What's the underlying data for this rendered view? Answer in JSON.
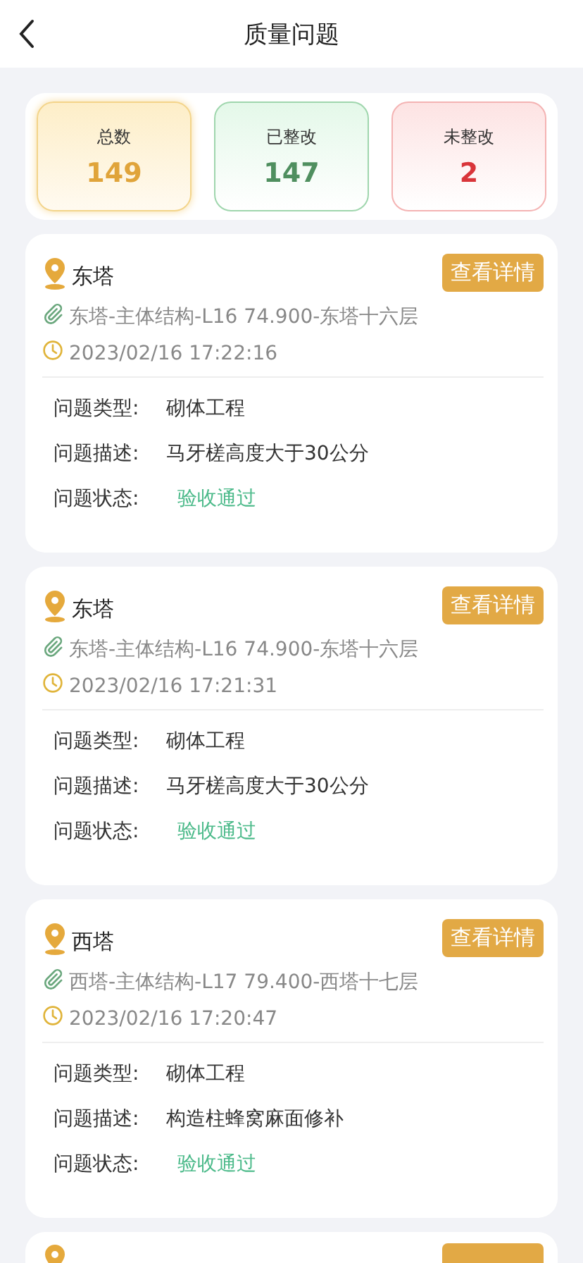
{
  "header": {
    "title": "质量问题"
  },
  "summary": [
    {
      "label": "总数",
      "value": "149",
      "kind": "total"
    },
    {
      "label": "已整改",
      "value": "147",
      "kind": "fixed"
    },
    {
      "label": "未整改",
      "value": "2",
      "kind": "open"
    }
  ],
  "issues": [
    {
      "location": "东塔",
      "button": "查看详情",
      "path": "东塔-主体结构-L16 74.900-东塔十六层",
      "time": "2023/02/16 17:22:16",
      "fields": [
        {
          "label": "问题类型:",
          "value": "砌体工程",
          "kind": "plain"
        },
        {
          "label": "问题描述:",
          "value": "马牙槎高度大于30公分",
          "kind": "plain"
        },
        {
          "label": "问题状态:",
          "value": "验收通过",
          "kind": "status"
        }
      ]
    },
    {
      "location": "东塔",
      "button": "查看详情",
      "path": "东塔-主体结构-L16 74.900-东塔十六层",
      "time": "2023/02/16 17:21:31",
      "fields": [
        {
          "label": "问题类型:",
          "value": "砌体工程",
          "kind": "plain"
        },
        {
          "label": "问题描述:",
          "value": "马牙槎高度大于30公分",
          "kind": "plain"
        },
        {
          "label": "问题状态:",
          "value": "验收通过",
          "kind": "status"
        }
      ]
    },
    {
      "location": "西塔",
      "button": "查看详情",
      "path": "西塔-主体结构-L17 79.400-西塔十七层",
      "time": "2023/02/16 17:20:47",
      "fields": [
        {
          "label": "问题类型:",
          "value": "砌体工程",
          "kind": "plain"
        },
        {
          "label": "问题描述:",
          "value": "构造柱蜂窝麻面修补",
          "kind": "plain"
        },
        {
          "label": "问题状态:",
          "value": "验收通过",
          "kind": "status"
        }
      ]
    }
  ],
  "more_below": true
}
